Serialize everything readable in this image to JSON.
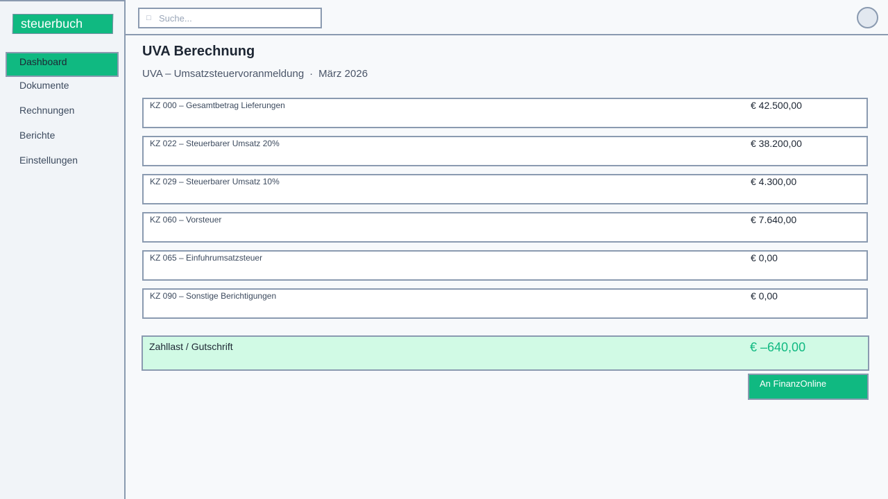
{
  "app": {
    "logo_text": "steuerbuch"
  },
  "sidebar": {
    "items": [
      {
        "label": "Dashboard"
      },
      {
        "label": "Dokumente"
      },
      {
        "label": "Rechnungen"
      },
      {
        "label": "Berichte"
      },
      {
        "label": "Einstellungen"
      }
    ]
  },
  "search": {
    "icon": "search-icon",
    "placeholder": "Suche..."
  },
  "header": {
    "avatar": "user-avatar"
  },
  "main": {
    "title": "UVA Berechnung",
    "subtitle": {
      "form": "UVA – Umsatzsteuervoranmeldung",
      "separator": "·",
      "period": "März 2026"
    },
    "rows": [
      {
        "label": "KZ 000 – Gesamtbetrag Lieferungen",
        "value": "€ 42.500,00"
      },
      {
        "label": "KZ 022 – Steuerbarer Umsatz 20%",
        "value": "€ 38.200,00"
      },
      {
        "label": "KZ 029 – Steuerbarer Umsatz 10%",
        "value": "€ 4.300,00"
      },
      {
        "label": "KZ 060 – Vorsteuer",
        "value": "€ 7.640,00"
      },
      {
        "label": "KZ 065 – Einfuhrumsatzsteuer",
        "value": "€ 0,00"
      },
      {
        "label": "KZ 090 – Sonstige Berichtigungen",
        "value": "€ 0,00"
      }
    ],
    "total": {
      "label": "Zahllast / Gutschrift",
      "value": "€ –640,00"
    },
    "submit_label": "An FinanzOnline"
  },
  "colors": {
    "accent": "#10b981",
    "accent_light": "#d1fae5",
    "border": "#8a9ab0",
    "background": "#f7f9fb"
  }
}
